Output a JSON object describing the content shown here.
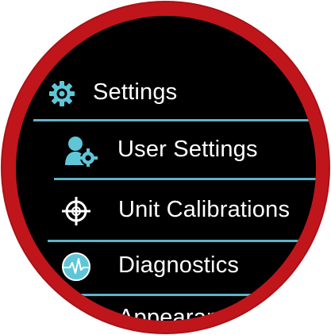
{
  "menu": {
    "header": {
      "label": "Settings",
      "icon": "gear-icon"
    },
    "items": [
      {
        "label": "User Settings",
        "icon": "user-gear-icon"
      },
      {
        "label": "Unit Calibrations",
        "icon": "crosshair-icon"
      },
      {
        "label": "Diagnostics",
        "icon": "heartbeat-icon"
      },
      {
        "label": "Appearance",
        "icon": "appearance-icon"
      }
    ]
  },
  "colors": {
    "bezel": "#c0161b",
    "screen": "#000000",
    "accent": "#5fc6d8",
    "divider": "#5fb3c6",
    "text": "#ffffff"
  }
}
